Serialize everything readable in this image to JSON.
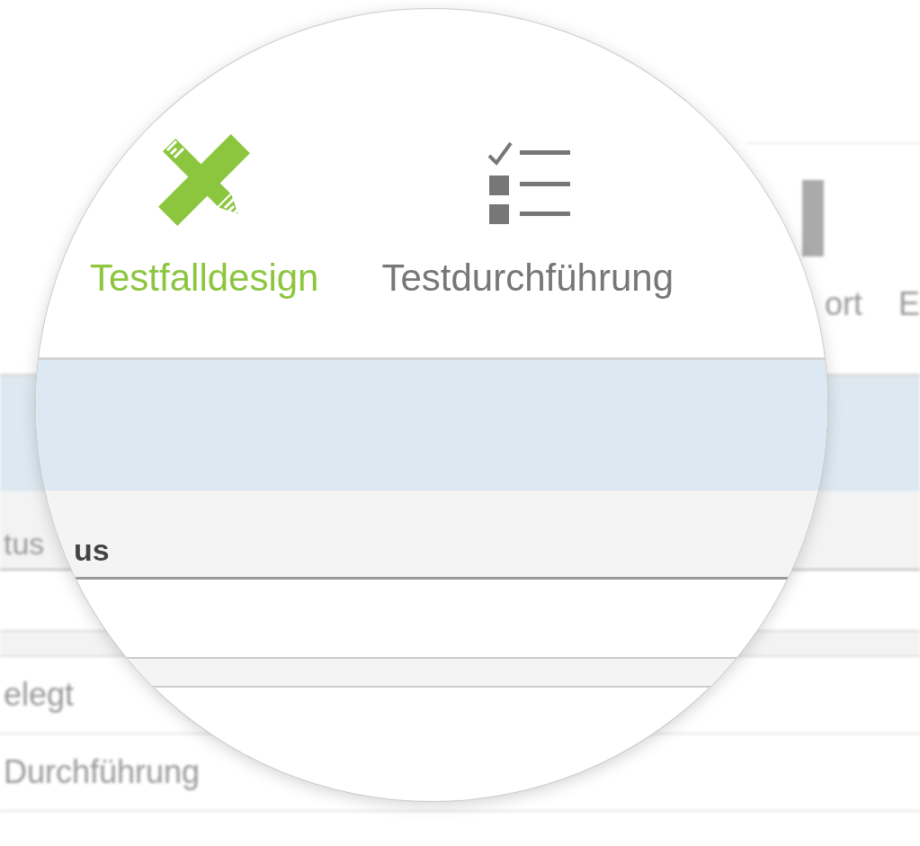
{
  "background": {
    "toolbar": [
      "ort",
      "E"
    ],
    "table_header": "tus",
    "rows": [
      "elegt",
      "Durchführung"
    ]
  },
  "magnifier": {
    "tabs": [
      {
        "label": "Testfalldesign",
        "selected": true
      },
      {
        "label": "Testdurchführung",
        "selected": false
      }
    ],
    "table_header": "us"
  }
}
